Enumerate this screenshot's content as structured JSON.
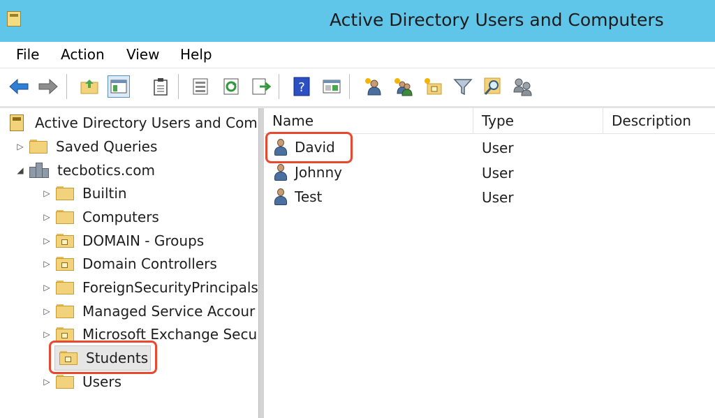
{
  "window": {
    "title": "Active Directory Users and Computers"
  },
  "menu": [
    "File",
    "Action",
    "View",
    "Help"
  ],
  "toolbar": {
    "buttons": [
      "back-arrow-icon",
      "forward-arrow-icon",
      "up-folder-icon",
      "show-hide-tree-icon",
      "clipboard-icon",
      "properties-icon",
      "refresh-icon",
      "export-list-icon",
      "help-icon",
      "console-tree-icon",
      "new-user-icon",
      "new-group-icon",
      "new-ou-icon",
      "filter-icon",
      "find-icon",
      "add-to-group-icon"
    ]
  },
  "tree": {
    "root": "Active Directory Users and Com",
    "saved_queries": "Saved Queries",
    "domain": "tecbotics.com",
    "containers": [
      {
        "label": "Builtin",
        "ou": false
      },
      {
        "label": "Computers",
        "ou": false
      },
      {
        "label": "DOMAIN - Groups",
        "ou": true
      },
      {
        "label": "Domain Controllers",
        "ou": true
      },
      {
        "label": "ForeignSecurityPrincipals",
        "ou": false
      },
      {
        "label": "Managed Service Accour",
        "ou": false
      },
      {
        "label": "Microsoft Exchange Secu",
        "ou": true
      },
      {
        "label": "Students",
        "ou": true,
        "selected": true
      },
      {
        "label": "Users",
        "ou": false
      }
    ]
  },
  "list": {
    "columns": [
      "Name",
      "Type",
      "Description"
    ],
    "rows": [
      {
        "name": "David",
        "type": "User",
        "description": ""
      },
      {
        "name": "Johnny",
        "type": "User",
        "description": ""
      },
      {
        "name": "Test",
        "type": "User",
        "description": ""
      }
    ]
  },
  "highlight_color": "#e8482f"
}
